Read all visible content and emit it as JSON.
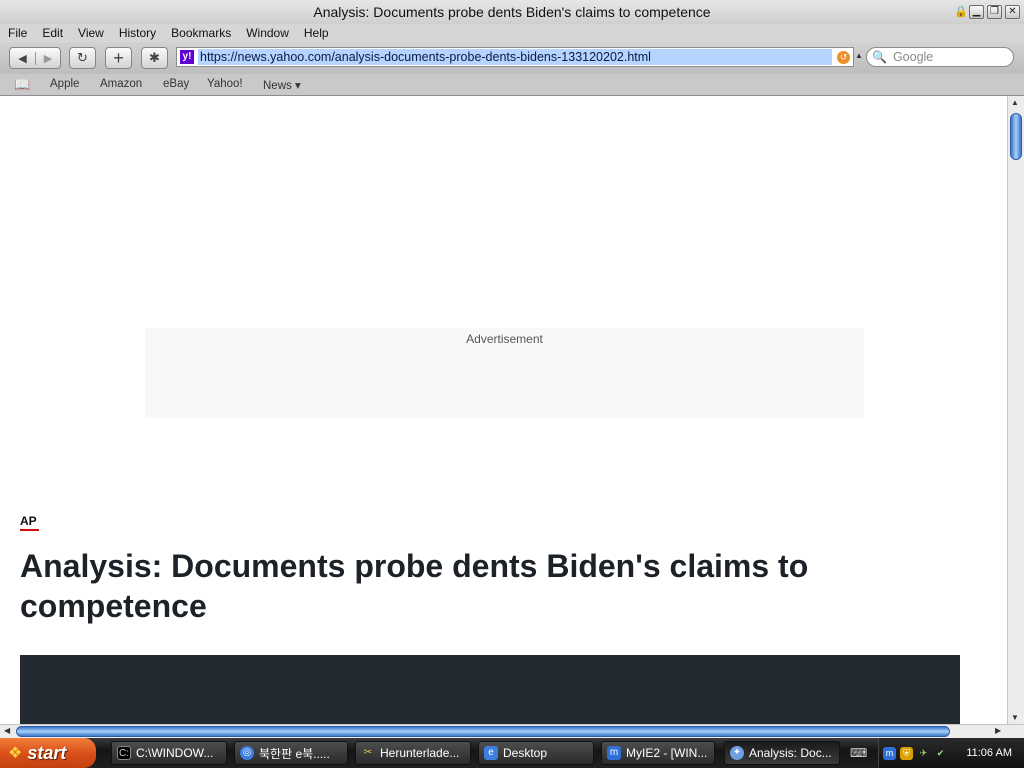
{
  "window": {
    "title": "Analysis: Documents probe dents Biden's claims to competence",
    "controls": [
      "lock",
      "minimize",
      "maximize",
      "close"
    ]
  },
  "menu": [
    "File",
    "Edit",
    "View",
    "History",
    "Bookmarks",
    "Window",
    "Help"
  ],
  "toolbar": {
    "back_icon": "◀",
    "forward_icon": "▶",
    "reload_icon": "↻",
    "add_icon": "+",
    "bug_icon": "✱",
    "favicon_letter": "y!",
    "url": "https://news.yahoo.com/analysis-documents-probe-dents-bidens-133120202.html",
    "search_placeholder": "Google"
  },
  "bookmarks": {
    "items": [
      "Apple",
      "Amazon",
      "eBay",
      "Yahoo!",
      "News ▾"
    ]
  },
  "page": {
    "ad_label": "Advertisement",
    "source": "AP",
    "headline": "Analysis: Documents probe dents Biden's claims to competence"
  },
  "taskbar": {
    "start_label": "start",
    "tasks": [
      "C:\\WINDOW...",
      "북한판 e북.....",
      "Herunterlade...",
      "Desktop",
      "MyIE2 - [WIN...",
      "Analysis: Doc..."
    ],
    "clock": "11:06 AM"
  },
  "colors": {
    "url_highlight": "#b5d4ff",
    "scroll_thumb": "#3b76c9",
    "ap_underline": "#d10e0e",
    "headline": "#1d2228",
    "hero_bg": "#232a31",
    "start_button": "#d9511a"
  }
}
